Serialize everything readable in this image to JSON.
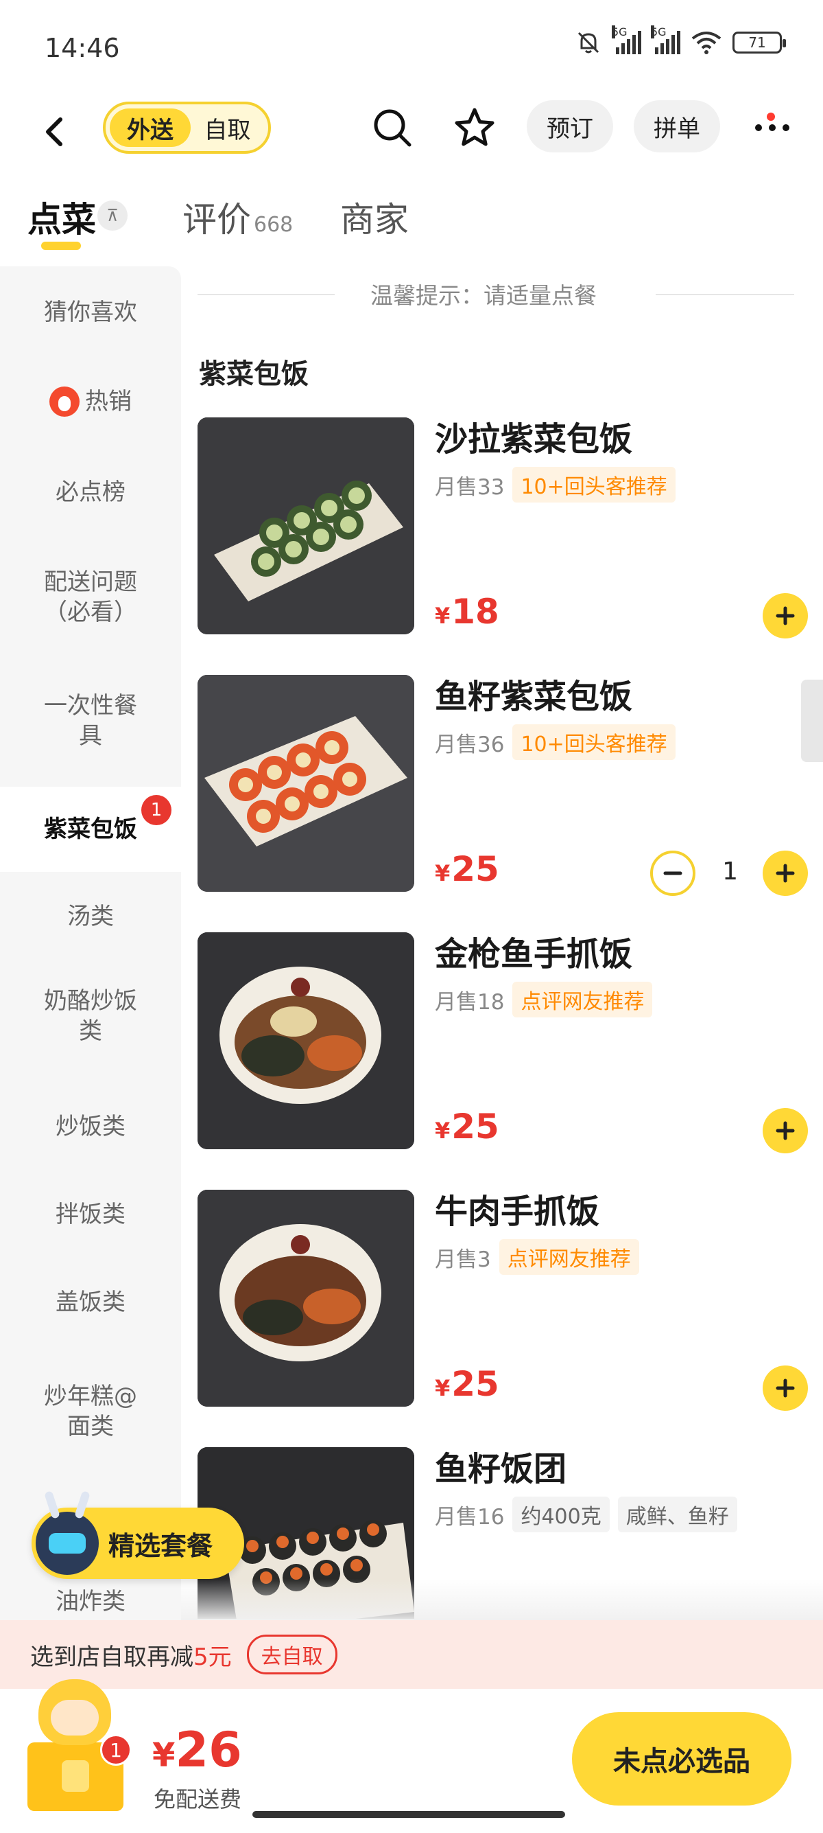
{
  "status_bar": {
    "time": "14:46",
    "net1": "5G",
    "net2": "5G",
    "battery": "71"
  },
  "header": {
    "mode_active": "外送",
    "mode_inactive": "自取",
    "reserve_label": "预订",
    "group_label": "拼单"
  },
  "tabs": [
    {
      "label": "点菜",
      "count": ""
    },
    {
      "label": "评价",
      "count": "668"
    },
    {
      "label": "商家",
      "count": ""
    }
  ],
  "sidebar": {
    "items": [
      {
        "label": "猜你喜欢"
      },
      {
        "label": "热销"
      },
      {
        "label": "必点榜"
      },
      {
        "label": "配送问题（必看）"
      },
      {
        "label": "一次性餐具"
      },
      {
        "label": "紫菜包饭",
        "badge": "1",
        "active": true
      },
      {
        "label": "汤类"
      },
      {
        "label": "奶酪炒饭类"
      },
      {
        "label": "炒饭类"
      },
      {
        "label": "拌饭类"
      },
      {
        "label": "盖饭类"
      },
      {
        "label": "炒年糕@面类"
      },
      {
        "label": "油炸类"
      }
    ]
  },
  "main": {
    "tip": "温馨提示：请适量点餐",
    "section_title": "紫菜包饭",
    "items": [
      {
        "name": "沙拉紫菜包饭",
        "sales": "月售33",
        "tags": [
          "10+回头客推荐"
        ],
        "price_symbol": "¥",
        "price": "18"
      },
      {
        "name": "鱼籽紫菜包饭",
        "sales": "月售36",
        "tags": [
          "10+回头客推荐"
        ],
        "price_symbol": "¥",
        "price": "25",
        "quantity": "1"
      },
      {
        "name": "金枪鱼手抓饭",
        "sales": "月售18",
        "tags": [
          "点评网友推荐"
        ],
        "price_symbol": "¥",
        "price": "25"
      },
      {
        "name": "牛肉手抓饭",
        "sales": "月售3",
        "tags": [
          "点评网友推荐"
        ],
        "price_symbol": "¥",
        "price": "25"
      },
      {
        "name": "鱼籽饭团",
        "sales": "月售16",
        "tags": [
          "约400克",
          "咸鲜、鱼籽"
        ]
      }
    ]
  },
  "combo": {
    "label": "精选套餐"
  },
  "promo": {
    "text_prefix": "选到店自取再减",
    "amount": "5元",
    "button": "去自取"
  },
  "cart": {
    "badge": "1",
    "price_symbol": "¥",
    "total": "26",
    "delivery": "免配送费",
    "checkout": "未点必选品"
  },
  "colors": {
    "brand_yellow": "#ffd836",
    "price_red": "#e8372f",
    "tag_orange": "#ff8a00"
  }
}
